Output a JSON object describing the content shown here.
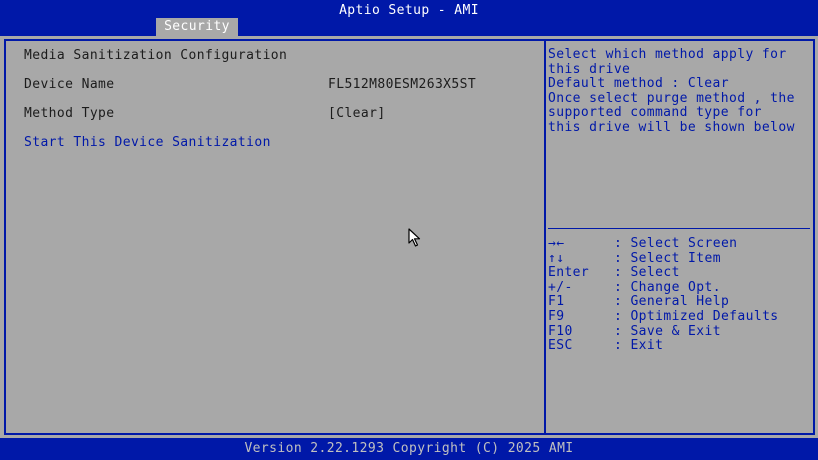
{
  "header": {
    "title": "Aptio Setup - AMI",
    "active_tab": "Security"
  },
  "main": {
    "section_title": "Media Sanitization Configuration",
    "device_name_label": "Device Name",
    "device_name_value": "FL512M80ESM263X5ST",
    "method_type_label": "Method Type",
    "method_type_value": "[Clear]",
    "start_action": "Start This Device Sanitization"
  },
  "help": {
    "lines": [
      "Select which method apply for",
      "this drive",
      "Default method : Clear",
      "Once select purge method , the",
      "supported command type for",
      "this drive will be shown below"
    ]
  },
  "keys": [
    {
      "key": "→←",
      "desc": ": Select Screen"
    },
    {
      "key": "↑↓",
      "desc": ": Select Item"
    },
    {
      "key": "Enter",
      "desc": ": Select"
    },
    {
      "key": "+/-",
      "desc": ": Change Opt."
    },
    {
      "key": "F1",
      "desc": ": General Help"
    },
    {
      "key": "F9",
      "desc": ": Optimized Defaults"
    },
    {
      "key": "F10",
      "desc": ": Save & Exit"
    },
    {
      "key": "ESC",
      "desc": ": Exit"
    }
  ],
  "footer": {
    "text": "Version 2.22.1293 Copyright (C) 2025 AMI"
  },
  "colors": {
    "background_blue": "#0018a8",
    "panel_gray": "#a8a8a8",
    "text_dark": "#1c1c1c",
    "text_white": "#ffffff"
  }
}
